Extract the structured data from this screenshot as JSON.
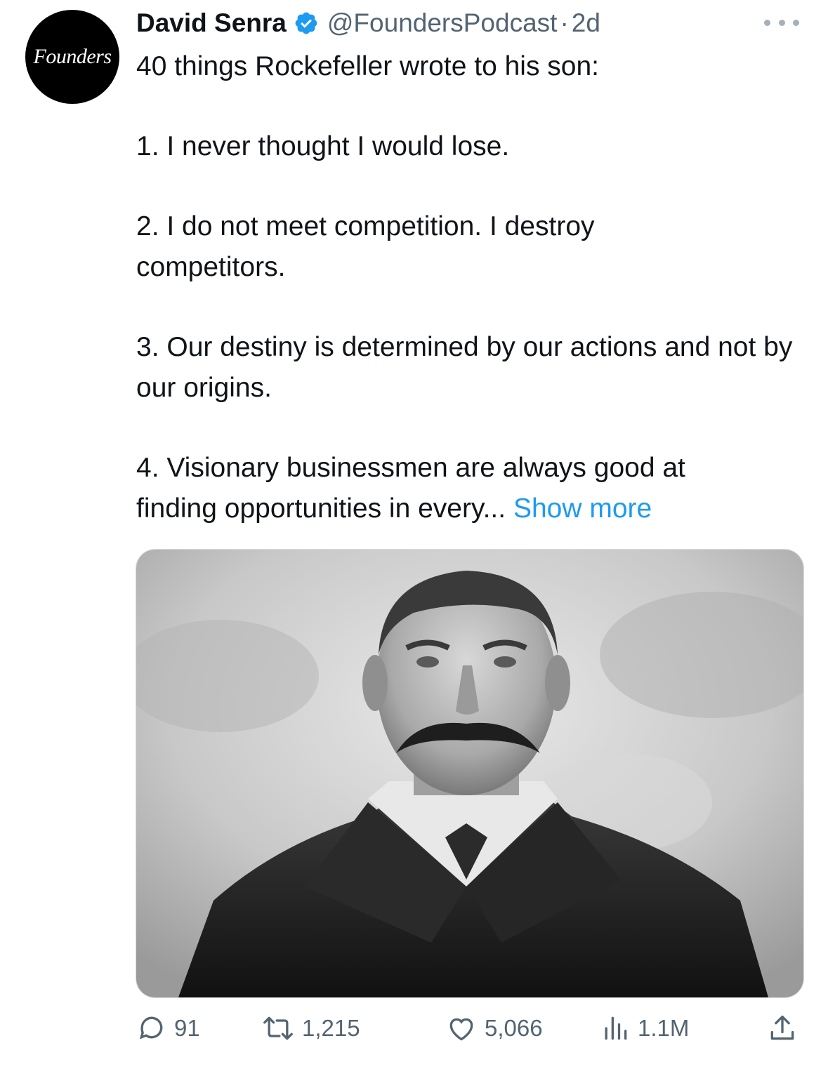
{
  "avatar": {
    "text": "Founders"
  },
  "author": {
    "name": "David Senra",
    "handle": "@FoundersPodcast",
    "separator": "·",
    "time": "2d"
  },
  "tweet": {
    "intro": "40 things Rockefeller wrote to his son:",
    "items": [
      "1. I never thought I would lose.",
      "2. I do not meet competition. I destroy competitors.",
      "3. Our destiny is determined by our actions and not by our origins.",
      "4. Visionary businessmen are always good at finding opportunities in every..."
    ],
    "show_more": "Show more"
  },
  "media": {
    "icon": "portrait-photo"
  },
  "actions": {
    "replies": "91",
    "reposts": "1,215",
    "likes": "5,066",
    "views": "1.1M"
  },
  "colors": {
    "accent": "#1d9bf0",
    "secondary": "#536471",
    "text": "#0f1419"
  }
}
